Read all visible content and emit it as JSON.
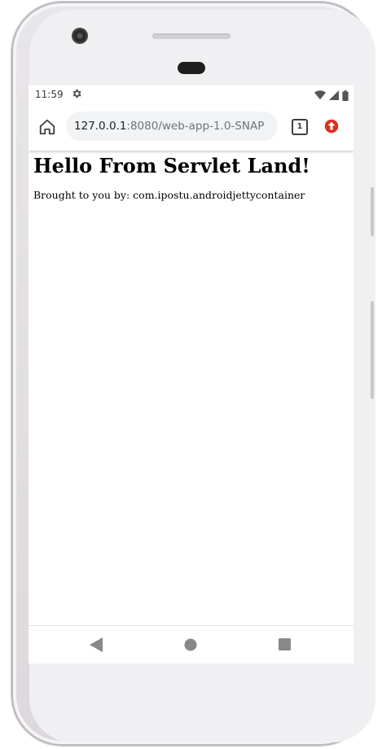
{
  "status_bar": {
    "time": "11:59",
    "settings_icon": "gear-icon",
    "wifi_icon": "wifi-icon",
    "signal_icon": "signal-icon",
    "battery_icon": "battery-icon"
  },
  "browser_toolbar": {
    "home_icon": "home-icon",
    "url_host": "127.0.0.1",
    "url_rest": ":8080/web-app-1.0-SNAP",
    "tab_count": "1",
    "update_icon": "update-arrow-icon",
    "accent_color": "#d93025"
  },
  "page": {
    "heading": "Hello From Servlet Land!",
    "body_text": "Brought to you by: com.ipostu.androidjettycontainer"
  },
  "nav_bar": {
    "back_icon": "back-triangle-icon",
    "home_icon": "home-circle-icon",
    "recents_icon": "recents-square-icon"
  }
}
